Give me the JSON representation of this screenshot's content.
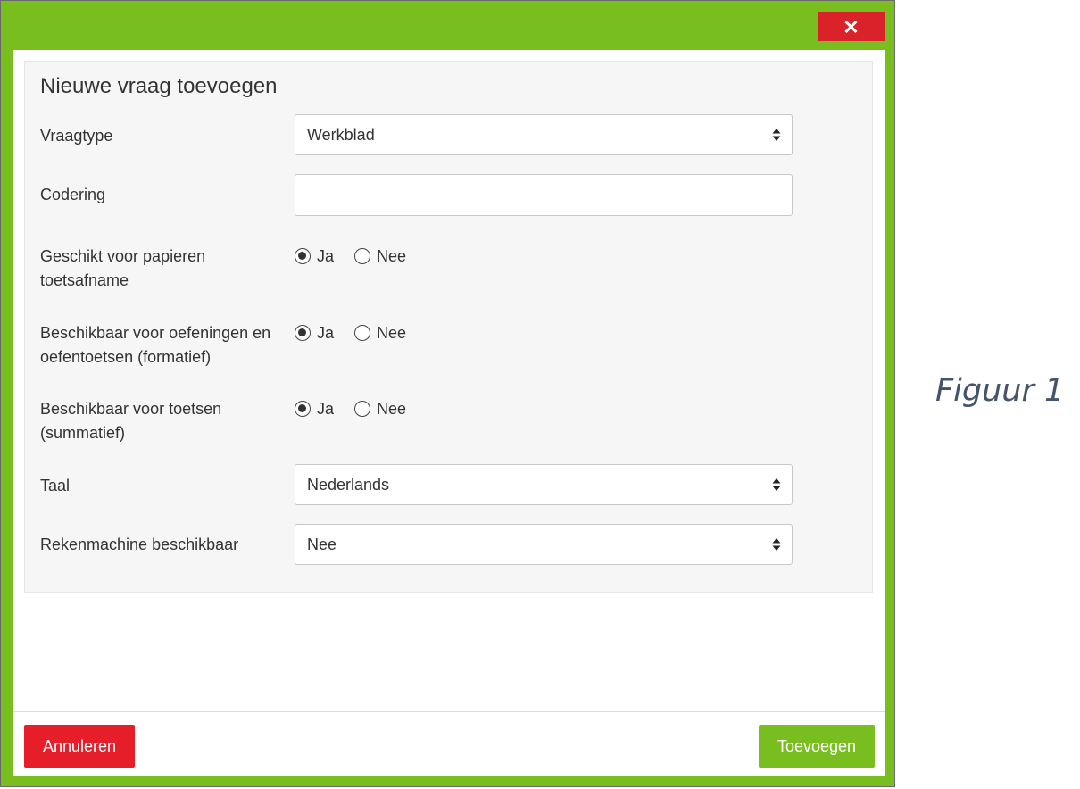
{
  "dialog": {
    "close_label": "✕",
    "title": "Nieuwe vraag toevoegen",
    "fields": {
      "vraagtype": {
        "label": "Vraagtype",
        "value": "Werkblad"
      },
      "codering": {
        "label": "Codering",
        "value": ""
      },
      "papier": {
        "label": "Geschikt voor papieren toetsafname",
        "yes": "Ja",
        "no": "Nee",
        "selected": "Ja"
      },
      "formatief": {
        "label": "Beschikbaar voor oefeningen en oefentoetsen (formatief)",
        "yes": "Ja",
        "no": "Nee",
        "selected": "Ja"
      },
      "summatief": {
        "label": "Beschikbaar voor toetsen (summatief)",
        "yes": "Ja",
        "no": "Nee",
        "selected": "Ja"
      },
      "taal": {
        "label": "Taal",
        "value": "Nederlands"
      },
      "rekenmachine": {
        "label": "Rekenmachine beschikbaar",
        "value": "Nee"
      }
    },
    "buttons": {
      "cancel": "Annuleren",
      "add": "Toevoegen"
    }
  },
  "caption": "Figuur 1",
  "colors": {
    "frame": "#79be1f",
    "close": "#d9222a",
    "cancel": "#e51e2a",
    "add": "#79be1f"
  }
}
